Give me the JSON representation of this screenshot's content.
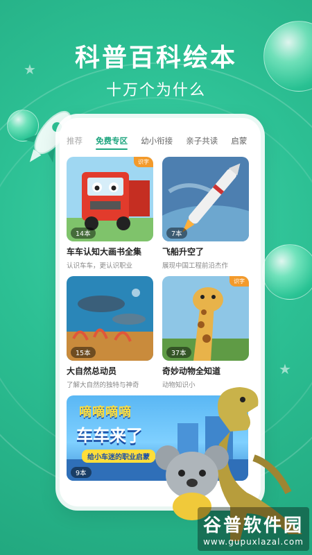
{
  "header": {
    "title": "科普百科绘本",
    "subtitle": "十万个为什么"
  },
  "tabs": [
    {
      "label": "推荐"
    },
    {
      "label": "免费专区"
    },
    {
      "label": "幼小衔接"
    },
    {
      "label": "亲子共读"
    },
    {
      "label": "启蒙"
    }
  ],
  "cards": [
    {
      "count": "14本",
      "tag": "识字",
      "title": "车车认知大画书全集",
      "desc": "认识车车，更认识职业"
    },
    {
      "count": "7本",
      "tag": "",
      "title": "飞船升空了",
      "desc": "展现中国工程前沿杰作"
    },
    {
      "count": "15本",
      "tag": "",
      "title": "大自然总动员",
      "desc": "了解大自然的独特与神奇"
    },
    {
      "count": "37本",
      "tag": "识字",
      "title": "奇妙动物全知道",
      "desc": "动物知识小"
    }
  ],
  "banner": {
    "line1": "嘀嘀嘀嘀",
    "line2": "车车来了",
    "line3": "给小车迷的职业启蒙",
    "count": "9本"
  },
  "watermark": {
    "line1": "谷普软件园",
    "line2": "www.gupuxlazal.com"
  },
  "colors": {
    "accent": "#1fa57f",
    "background": "#2cbf93",
    "tag": "#f39a2b"
  }
}
